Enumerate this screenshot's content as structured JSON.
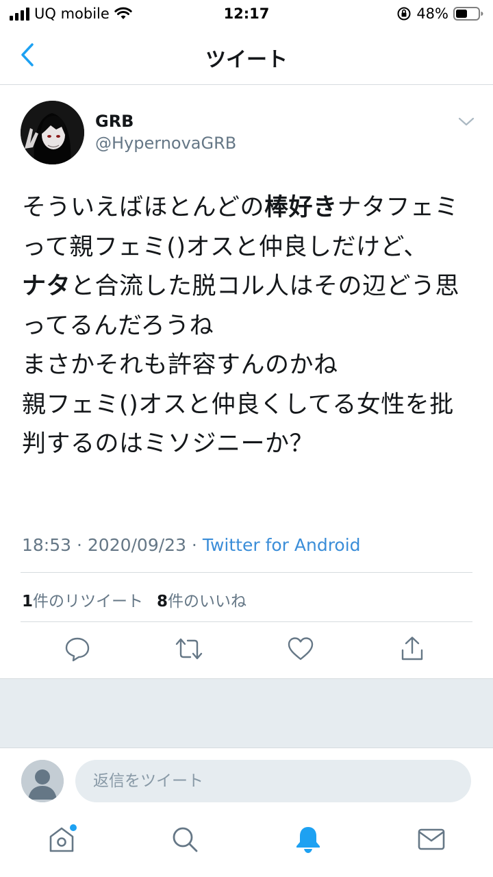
{
  "status_bar": {
    "carrier": "UQ mobile",
    "time": "12:17",
    "battery": "48%"
  },
  "header": {
    "title": "ツイート"
  },
  "tweet": {
    "name": "GRB",
    "handle": "@HypernovaGRB",
    "text_segments": [
      {
        "t": "そういえばほとんどの",
        "bold": false
      },
      {
        "t": "棒好き",
        "bold": true
      },
      {
        "t": "ナタフェミって親フェミ()オスと仲良しだけど、\n",
        "bold": false
      },
      {
        "t": "ナタ",
        "bold": true
      },
      {
        "t": "と合流した脱コル人はその辺どう思ってるんだろうね\nまさかそれも許容すんのかね\n親フェミ()オスと仲良くしてる女性を批判するのはミソジニーか？",
        "bold": false
      }
    ],
    "timestamp": "18:53 · 2020/09/23 · ",
    "source": "Twitter for Android",
    "retweet_count": "1",
    "retweet_label": "件のリツイート",
    "like_count": "8",
    "like_label": "件のいいね"
  },
  "reply": {
    "placeholder": "返信をツイート"
  },
  "icons": {
    "back": "chevron-left-icon",
    "menu": "chevron-down-icon",
    "reply": "reply-icon",
    "retweet": "retweet-icon",
    "like": "heart-icon",
    "share": "share-icon",
    "home": "home-icon",
    "search": "search-icon",
    "notifications": "bell-icon",
    "messages": "envelope-icon"
  },
  "colors": {
    "accent": "#1da1f2",
    "text": "#14171a",
    "secondary": "#657786",
    "divider": "#d6dbdf",
    "background_gray": "#e6ecf0"
  }
}
